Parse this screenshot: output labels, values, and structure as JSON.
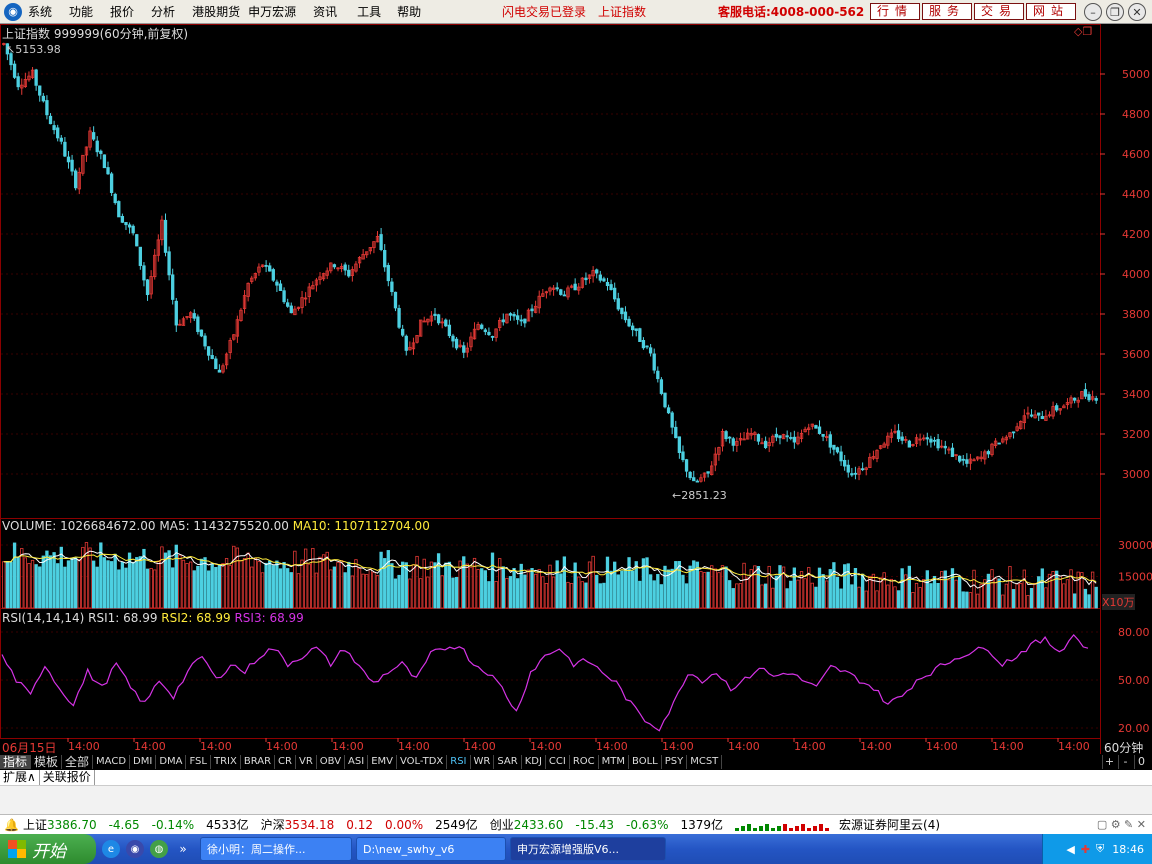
{
  "menu": {
    "items": [
      "系统",
      "功能",
      "报价",
      "分析",
      "港股期货",
      "申万宏源",
      "资讯",
      "工具",
      "帮助"
    ],
    "status_login": "闪电交易已登录",
    "status_index": "上证指数",
    "hotline": "客服电话:4008-000-562",
    "top_buttons": [
      "行情",
      "服务",
      "交易",
      "网站"
    ]
  },
  "chart_header": {
    "title": "上证指数 999999(60分钟,前复权)",
    "max_label": "5153.98",
    "min_label": "2851.23"
  },
  "volume_header": {
    "volume": "VOLUME: 1026684672.00",
    "ma5": "MA5: 1143275520.00",
    "ma10": "MA10: 1107112704.00",
    "unit": "X10万"
  },
  "rsi_header": {
    "name": "RSI(14,14,14)",
    "rsi1": "RSI1: 68.99",
    "rsi2": "RSI2: 68.99",
    "rsi3": "RSI3: 68.99"
  },
  "time_axis": {
    "first": "06月15日",
    "tick": "14:00",
    "period": "60分钟"
  },
  "colors": {
    "up": "#e53935",
    "down": "#4dd0e1",
    "ma5": "#ffffff",
    "ma10": "#ffeb3b",
    "rsi": "#d633e6",
    "axis_text": "#e53935"
  },
  "indicator_tabs": [
    "指标",
    "模板",
    "全部",
    "MACD",
    "DMI",
    "DMA",
    "FSL",
    "TRIX",
    "BRAR",
    "CR",
    "VR",
    "OBV",
    "ASI",
    "EMV",
    "VOL-TDX",
    "RSI",
    "WR",
    "SAR",
    "KDJ",
    "CCI",
    "ROC",
    "MTM",
    "BOLL",
    "PSY",
    "MCST"
  ],
  "active_indicator": "RSI",
  "indicator_controls": [
    "+",
    "-",
    "0"
  ],
  "extra_tabs": [
    "扩展∧",
    "关联报价"
  ],
  "ticker": {
    "sh_name": "上证",
    "sh_price": "3386.70",
    "sh_change": "-4.65",
    "sh_pct": "-0.14%",
    "sh_amount": "4533亿",
    "hs_name": "沪深",
    "hs_price": "3534.18",
    "hs_change": "0.12",
    "hs_pct": "0.00%",
    "hs_amount": "2549亿",
    "cy_name": "创业",
    "cy_price": "2433.60",
    "cy_change": "-15.43",
    "cy_pct": "-0.63%",
    "cy_amount": "1379亿",
    "broker": "宏源证券阿里云(4)"
  },
  "taskbar": {
    "start": "开始",
    "tasks": [
      "徐小明：周二操作...",
      "D:\\new_swhy_v6",
      "申万宏源增强版V6..."
    ],
    "clock": "18:46"
  },
  "chart_data": {
    "type": "candlestick",
    "title": "上证指数 999999(60分钟,前复权)",
    "price_axis_ticks": [
      5000,
      4800,
      4600,
      4400,
      4200,
      4000,
      3800,
      3600,
      3400,
      3200,
      3000
    ],
    "price_range": [
      2800,
      5200
    ],
    "highest": 5153.98,
    "lowest": 2851.23,
    "price_path": [
      [
        0,
        5150
      ],
      [
        4,
        4950
      ],
      [
        8,
        5000
      ],
      [
        12,
        4800
      ],
      [
        16,
        4650
      ],
      [
        20,
        4450
      ],
      [
        24,
        4700
      ],
      [
        28,
        4550
      ],
      [
        32,
        4300
      ],
      [
        36,
        4200
      ],
      [
        40,
        3900
      ],
      [
        44,
        4250
      ],
      [
        48,
        3750
      ],
      [
        52,
        3800
      ],
      [
        56,
        3650
      ],
      [
        60,
        3500
      ],
      [
        64,
        3700
      ],
      [
        68,
        3950
      ],
      [
        72,
        4050
      ],
      [
        76,
        3950
      ],
      [
        80,
        3800
      ],
      [
        84,
        3900
      ],
      [
        88,
        4000
      ],
      [
        92,
        4050
      ],
      [
        96,
        4000
      ],
      [
        100,
        4100
      ],
      [
        104,
        4180
      ],
      [
        108,
        3900
      ],
      [
        112,
        3600
      ],
      [
        116,
        3750
      ],
      [
        120,
        3800
      ],
      [
        124,
        3700
      ],
      [
        128,
        3600
      ],
      [
        132,
        3750
      ],
      [
        136,
        3700
      ],
      [
        140,
        3800
      ],
      [
        144,
        3750
      ],
      [
        148,
        3850
      ],
      [
        152,
        3950
      ],
      [
        156,
        3900
      ],
      [
        160,
        3950
      ],
      [
        164,
        4000
      ],
      [
        168,
        3950
      ],
      [
        172,
        3800
      ],
      [
        176,
        3700
      ],
      [
        180,
        3600
      ],
      [
        184,
        3350
      ],
      [
        188,
        3100
      ],
      [
        192,
        2950
      ],
      [
        196,
        3000
      ],
      [
        200,
        3200
      ],
      [
        204,
        3150
      ],
      [
        208,
        3200
      ],
      [
        212,
        3150
      ],
      [
        216,
        3200
      ],
      [
        220,
        3150
      ],
      [
        224,
        3250
      ],
      [
        228,
        3200
      ],
      [
        232,
        3100
      ],
      [
        236,
        3000
      ],
      [
        240,
        3050
      ],
      [
        244,
        3150
      ],
      [
        248,
        3200
      ],
      [
        252,
        3150
      ],
      [
        256,
        3200
      ],
      [
        260,
        3150
      ],
      [
        264,
        3100
      ],
      [
        268,
        3050
      ],
      [
        272,
        3080
      ],
      [
        276,
        3150
      ],
      [
        280,
        3200
      ],
      [
        284,
        3300
      ],
      [
        288,
        3280
      ],
      [
        292,
        3320
      ],
      [
        296,
        3350
      ],
      [
        300,
        3400
      ],
      [
        303,
        3386
      ]
    ],
    "volume_axis_ticks": [
      30000,
      15000
    ],
    "volume_range": [
      0,
      40000
    ],
    "volume_unit": "X10万",
    "rsi_axis_ticks": [
      80.0,
      50.0,
      20.0
    ],
    "rsi_range": [
      15,
      85
    ],
    "rsi_path": [
      [
        0,
        65
      ],
      [
        3,
        50
      ],
      [
        6,
        40
      ],
      [
        9,
        60
      ],
      [
        12,
        45
      ],
      [
        15,
        35
      ],
      [
        18,
        55
      ],
      [
        21,
        45
      ],
      [
        24,
        60
      ],
      [
        27,
        45
      ],
      [
        30,
        35
      ],
      [
        33,
        50
      ],
      [
        36,
        40
      ],
      [
        39,
        55
      ],
      [
        42,
        65
      ],
      [
        45,
        50
      ],
      [
        48,
        60
      ],
      [
        51,
        55
      ],
      [
        54,
        65
      ],
      [
        57,
        70
      ],
      [
        60,
        60
      ],
      [
        63,
        65
      ],
      [
        66,
        70
      ],
      [
        69,
        60
      ],
      [
        72,
        70
      ],
      [
        75,
        58
      ],
      [
        78,
        48
      ],
      [
        81,
        55
      ],
      [
        84,
        60
      ],
      [
        87,
        50
      ],
      [
        90,
        66
      ],
      [
        93,
        70
      ],
      [
        96,
        72
      ],
      [
        99,
        60
      ],
      [
        102,
        55
      ],
      [
        105,
        45
      ],
      [
        108,
        30
      ],
      [
        111,
        55
      ],
      [
        114,
        65
      ],
      [
        117,
        70
      ],
      [
        120,
        60
      ],
      [
        123,
        62
      ],
      [
        126,
        55
      ],
      [
        129,
        48
      ],
      [
        132,
        35
      ],
      [
        135,
        25
      ],
      [
        138,
        20
      ],
      [
        141,
        35
      ],
      [
        144,
        55
      ],
      [
        147,
        50
      ],
      [
        150,
        55
      ],
      [
        153,
        45
      ],
      [
        156,
        50
      ],
      [
        159,
        58
      ],
      [
        162,
        52
      ],
      [
        165,
        55
      ],
      [
        168,
        50
      ],
      [
        171,
        45
      ],
      [
        174,
        58
      ],
      [
        177,
        55
      ],
      [
        180,
        50
      ],
      [
        183,
        45
      ],
      [
        186,
        35
      ],
      [
        189,
        40
      ],
      [
        192,
        50
      ],
      [
        195,
        55
      ],
      [
        198,
        60
      ],
      [
        201,
        65
      ],
      [
        204,
        68
      ],
      [
        207,
        70
      ],
      [
        210,
        60
      ],
      [
        213,
        65
      ],
      [
        216,
        72
      ],
      [
        219,
        75
      ],
      [
        222,
        68
      ],
      [
        225,
        78
      ],
      [
        228,
        69
      ]
    ]
  }
}
